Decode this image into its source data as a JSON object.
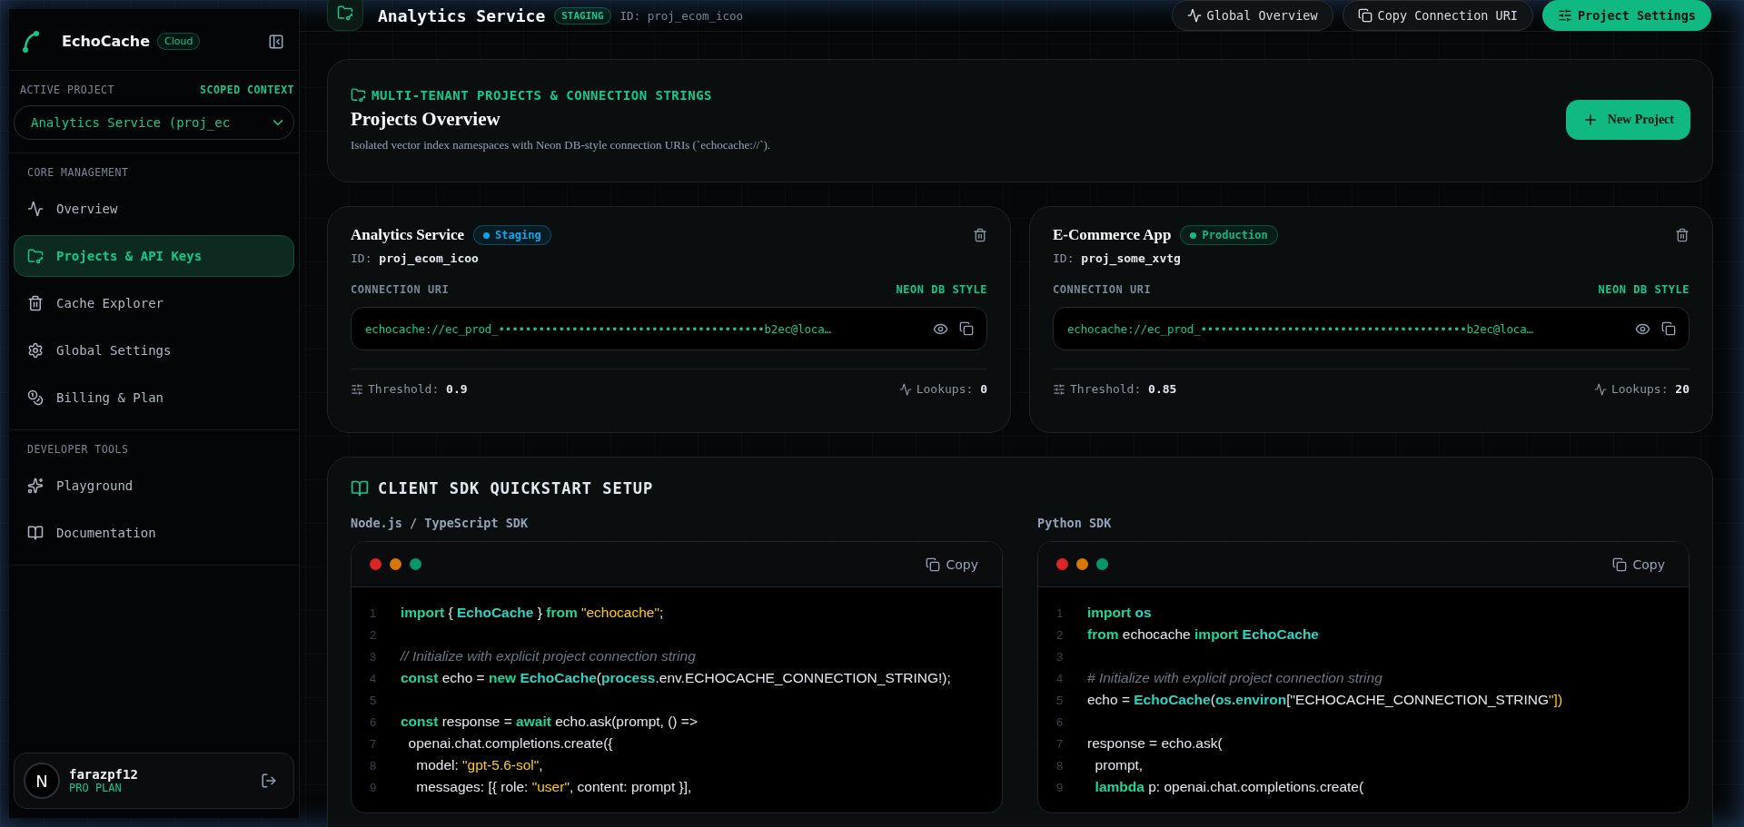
{
  "sidebar": {
    "brand": "EchoCache",
    "brand_badge": "Cloud",
    "active_project_label": "ACTIVE PROJECT",
    "scoped_label": "SCOPED CONTEXT",
    "project_select": {
      "value": "Analytics Service (proj_ec"
    },
    "sections": [
      {
        "title": "CORE MANAGEMENT",
        "items": [
          {
            "label": "Overview",
            "selected": false
          },
          {
            "label": "Projects & API Keys",
            "selected": true
          },
          {
            "label": "Cache Explorer",
            "selected": false
          },
          {
            "label": "Global Settings",
            "selected": false
          },
          {
            "label": "Billing & Plan",
            "selected": false
          }
        ]
      },
      {
        "title": "DEVELOPER TOOLS",
        "items": [
          {
            "label": "Playground",
            "selected": false
          },
          {
            "label": "Documentation",
            "selected": false
          }
        ]
      }
    ],
    "user": {
      "avatar": "N",
      "name": "farazpf12",
      "plan": "PRO PLAN"
    }
  },
  "header": {
    "title": "Analytics Service",
    "env_badge": "STAGING",
    "id": "ID: proj_ecom_icoo",
    "buttons": [
      {
        "label": "Global Overview",
        "primary": false
      },
      {
        "label": "Copy Connection URI",
        "primary": false
      },
      {
        "label": "Project Settings",
        "primary": true
      }
    ]
  },
  "overview": {
    "eyebrow": "MULTI-TENANT PROJECTS & CONNECTION STRINGS",
    "title": "Projects Overview",
    "description": "Isolated vector index namespaces with Neon DB-style connection URIs (`echocache://`).",
    "new_button": "New Project"
  },
  "projects": [
    {
      "name": "Analytics Service",
      "status": "Staging",
      "color": "#0ea5e9",
      "id_label": "ID:",
      "id": "proj_ecom_icoo",
      "uri_label": "CONNECTION URI",
      "uri_style": "NEON DB STYLE",
      "uri": "echocache://ec_prod_••••••••••••••••••••••••••••••••••••••••b2ec@loca…",
      "threshold_label": "Threshold:",
      "threshold": "0.9",
      "lookups_label": "Lookups:",
      "lookups": "0"
    },
    {
      "name": "E-Commerce App",
      "status": "Production",
      "color": "#10b981",
      "id_label": "ID:",
      "id": "proj_some_xvtg",
      "uri_label": "CONNECTION URI",
      "uri_style": "NEON DB STYLE",
      "uri": "echocache://ec_prod_••••••••••••••••••••••••••••••••••••••••b2ec@loca…",
      "threshold_label": "Threshold:",
      "threshold": "0.85",
      "lookups_label": "Lookups:",
      "lookups": "20"
    }
  ],
  "sdk": {
    "title": "CLIENT SDK QUICKSTART SETUP",
    "blocks": [
      {
        "label": "Node.js / TypeScript SDK",
        "copy": "Copy",
        "lines": [
          {
            "n": "1",
            "tokens": [
              {
                "t": "import",
                "kind": "keyword"
              },
              {
                "t": " { ",
                "kind": "plain"
              },
              {
                "t": "EchoCache",
                "kind": "name"
              },
              {
                "t": " } ",
                "kind": "plain"
              },
              {
                "t": "from",
                "kind": "keyword"
              },
              {
                "t": " \"echocache\"",
                "kind": "string"
              },
              {
                "t": ";",
                "kind": "plain"
              }
            ]
          },
          {
            "n": "2"
          },
          {
            "n": "3",
            "tokens": [
              {
                "t": "// Initialize with explicit project connection string",
                "kind": "comment"
              }
            ]
          },
          {
            "n": "4",
            "tokens": [
              {
                "t": "const",
                "kind": "keyword"
              },
              {
                "t": " echo = ",
                "kind": "plain"
              },
              {
                "t": "new",
                "kind": "keyword"
              },
              {
                "t": " EchoCache",
                "kind": "name"
              },
              {
                "t": "(",
                "kind": "plain"
              },
              {
                "t": "process",
                "kind": "name"
              },
              {
                "t": ".env.ECHOCACHE_CONNECTION_STRING!);",
                "kind": "plain"
              }
            ]
          },
          {
            "n": "5"
          },
          {
            "n": "6",
            "tokens": [
              {
                "t": "const",
                "kind": "keyword"
              },
              {
                "t": " response = ",
                "kind": "plain"
              },
              {
                "t": "await",
                "kind": "keyword"
              },
              {
                "t": " echo.ask(prompt, () =>",
                "kind": "plain"
              }
            ]
          },
          {
            "n": "7",
            "tokens": [
              {
                "t": "  openai.chat.completions.create({",
                "kind": "plain"
              }
            ]
          },
          {
            "n": "8",
            "tokens": [
              {
                "t": "    model: ",
                "kind": "plain"
              },
              {
                "t": "\"gpt-5.6-sol\"",
                "kind": "string"
              },
              {
                "t": ",",
                "kind": "plain"
              }
            ]
          },
          {
            "n": "9",
            "tokens": [
              {
                "t": "    messages: [{ role: ",
                "kind": "plain"
              },
              {
                "t": "\"user\"",
                "kind": "string"
              },
              {
                "t": ", content: prompt }],",
                "kind": "plain"
              }
            ]
          }
        ]
      },
      {
        "label": "Python SDK",
        "copy": "Copy",
        "lines": [
          {
            "n": "1",
            "tokens": [
              {
                "t": "import",
                "kind": "keyword"
              },
              {
                "t": " os",
                "kind": "name"
              }
            ]
          },
          {
            "n": "2",
            "tokens": [
              {
                "t": "from",
                "kind": "keyword"
              },
              {
                "t": " echocache ",
                "kind": "plain"
              },
              {
                "t": "import",
                "kind": "keyword"
              },
              {
                "t": " EchoCache",
                "kind": "name"
              }
            ]
          },
          {
            "n": "3"
          },
          {
            "n": "4",
            "tokens": [
              {
                "t": "# Initialize with explicit project connection string",
                "kind": "comment"
              }
            ]
          },
          {
            "n": "5",
            "tokens": [
              {
                "t": "echo = ",
                "kind": "plain"
              },
              {
                "t": "EchoCache",
                "kind": "name"
              },
              {
                "t": "(",
                "kind": "plain"
              },
              {
                "t": "os.environ",
                "kind": "name"
              },
              {
                "t": "[\"ECHOCACHE_CONNECTION_STRING",
                "kind": "plain"
              },
              {
                "t": "\"])",
                "kind": "string"
              }
            ]
          },
          {
            "n": "6"
          },
          {
            "n": "7",
            "tokens": [
              {
                "t": "response = echo.ask(",
                "kind": "plain"
              }
            ]
          },
          {
            "n": "8",
            "tokens": [
              {
                "t": "  prompt,",
                "kind": "plain"
              }
            ]
          },
          {
            "n": "9",
            "tokens": [
              {
                "t": "  lambda",
                "kind": "keyword"
              },
              {
                "t": " p: openai.chat.completions.create(",
                "kind": "plain"
              }
            ]
          }
        ]
      }
    ]
  }
}
